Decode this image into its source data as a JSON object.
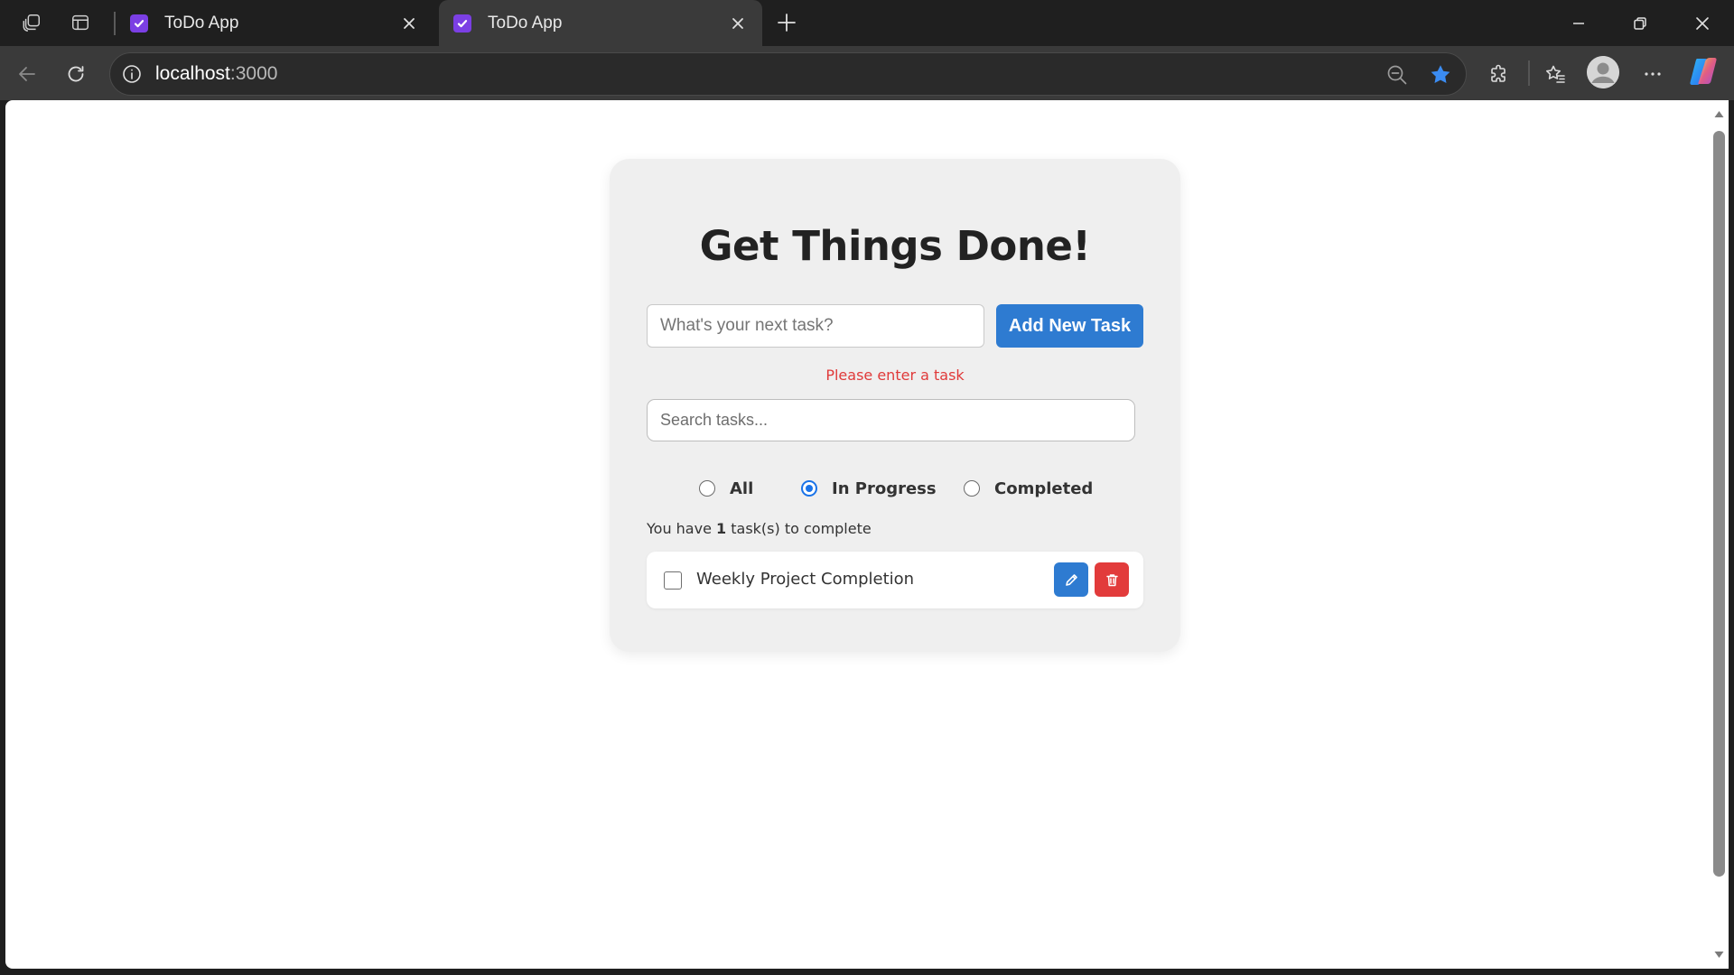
{
  "browser": {
    "tabs": [
      {
        "title": "ToDo App",
        "active": false
      },
      {
        "title": "ToDo App",
        "active": true
      }
    ],
    "url_host": "localhost",
    "url_port": ":3000",
    "accent_color": "#1a73e8"
  },
  "app": {
    "heading": "Get Things Done!",
    "task_input_placeholder": "What's your next task?",
    "add_button_label": "Add New Task",
    "error_message": "Please enter a task",
    "search_placeholder": "Search tasks...",
    "filters": [
      {
        "label": "All",
        "checked": false
      },
      {
        "label": "In Progress",
        "checked": true
      },
      {
        "label": "Completed",
        "checked": false
      }
    ],
    "count_prefix": "You have ",
    "count_value": "1",
    "count_suffix": " task(s) to complete",
    "tasks": [
      {
        "text": "Weekly Project Completion",
        "done": false
      }
    ],
    "colors": {
      "primary": "#2e7bd1",
      "danger": "#e23b3b",
      "error_text": "#e03a3a"
    }
  }
}
